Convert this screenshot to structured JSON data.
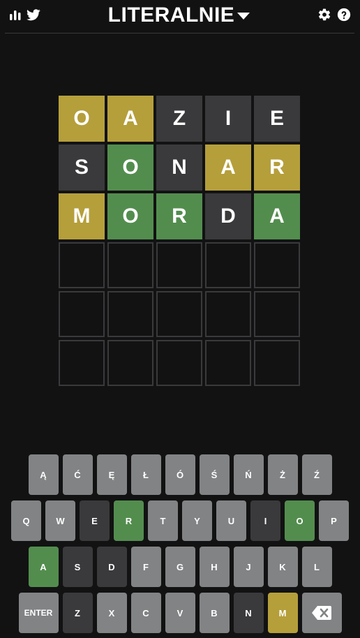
{
  "header": {
    "title": "LITERALNIE",
    "icons_left": [
      "stats-icon",
      "twitter-icon"
    ],
    "icons_right": [
      "gear-icon",
      "help-icon"
    ]
  },
  "colors": {
    "background": "#121213",
    "correct": "#538d4e",
    "present": "#b59f3b",
    "absent": "#3a3a3c",
    "key_default": "#818384",
    "empty_border": "#3a3a3c"
  },
  "board": {
    "rows": [
      [
        {
          "letter": "O",
          "state": "present"
        },
        {
          "letter": "A",
          "state": "present"
        },
        {
          "letter": "Z",
          "state": "absent"
        },
        {
          "letter": "I",
          "state": "absent"
        },
        {
          "letter": "E",
          "state": "absent"
        }
      ],
      [
        {
          "letter": "S",
          "state": "absent"
        },
        {
          "letter": "O",
          "state": "correct"
        },
        {
          "letter": "N",
          "state": "absent"
        },
        {
          "letter": "A",
          "state": "present"
        },
        {
          "letter": "R",
          "state": "present"
        }
      ],
      [
        {
          "letter": "M",
          "state": "present"
        },
        {
          "letter": "O",
          "state": "correct"
        },
        {
          "letter": "R",
          "state": "correct"
        },
        {
          "letter": "D",
          "state": "absent"
        },
        {
          "letter": "A",
          "state": "correct"
        }
      ],
      [
        {
          "letter": "",
          "state": "empty"
        },
        {
          "letter": "",
          "state": "empty"
        },
        {
          "letter": "",
          "state": "empty"
        },
        {
          "letter": "",
          "state": "empty"
        },
        {
          "letter": "",
          "state": "empty"
        }
      ],
      [
        {
          "letter": "",
          "state": "empty"
        },
        {
          "letter": "",
          "state": "empty"
        },
        {
          "letter": "",
          "state": "empty"
        },
        {
          "letter": "",
          "state": "empty"
        },
        {
          "letter": "",
          "state": "empty"
        }
      ],
      [
        {
          "letter": "",
          "state": "empty"
        },
        {
          "letter": "",
          "state": "empty"
        },
        {
          "letter": "",
          "state": "empty"
        },
        {
          "letter": "",
          "state": "empty"
        },
        {
          "letter": "",
          "state": "empty"
        }
      ]
    ]
  },
  "keyboard": {
    "rows": [
      [
        {
          "label": "Ą",
          "state": "default"
        },
        {
          "label": "Ć",
          "state": "default"
        },
        {
          "label": "Ę",
          "state": "default"
        },
        {
          "label": "Ł",
          "state": "default"
        },
        {
          "label": "Ó",
          "state": "default"
        },
        {
          "label": "Ś",
          "state": "default"
        },
        {
          "label": "Ń",
          "state": "default"
        },
        {
          "label": "Ż",
          "state": "default"
        },
        {
          "label": "Ź",
          "state": "default"
        }
      ],
      [
        {
          "label": "Q",
          "state": "default"
        },
        {
          "label": "W",
          "state": "default"
        },
        {
          "label": "E",
          "state": "absent"
        },
        {
          "label": "R",
          "state": "correct"
        },
        {
          "label": "T",
          "state": "default"
        },
        {
          "label": "Y",
          "state": "default"
        },
        {
          "label": "U",
          "state": "default"
        },
        {
          "label": "I",
          "state": "absent"
        },
        {
          "label": "O",
          "state": "correct"
        },
        {
          "label": "P",
          "state": "default"
        }
      ],
      [
        {
          "label": "A",
          "state": "correct"
        },
        {
          "label": "S",
          "state": "absent"
        },
        {
          "label": "D",
          "state": "absent"
        },
        {
          "label": "F",
          "state": "default"
        },
        {
          "label": "G",
          "state": "default"
        },
        {
          "label": "H",
          "state": "default"
        },
        {
          "label": "J",
          "state": "default"
        },
        {
          "label": "K",
          "state": "default"
        },
        {
          "label": "L",
          "state": "default"
        }
      ],
      [
        {
          "label": "ENTER",
          "state": "default",
          "wide": true
        },
        {
          "label": "Z",
          "state": "absent"
        },
        {
          "label": "X",
          "state": "default"
        },
        {
          "label": "C",
          "state": "default"
        },
        {
          "label": "V",
          "state": "default"
        },
        {
          "label": "B",
          "state": "default"
        },
        {
          "label": "N",
          "state": "absent"
        },
        {
          "label": "M",
          "state": "present"
        },
        {
          "label": "",
          "state": "default",
          "wide": true,
          "icon": "backspace-icon"
        }
      ]
    ]
  }
}
